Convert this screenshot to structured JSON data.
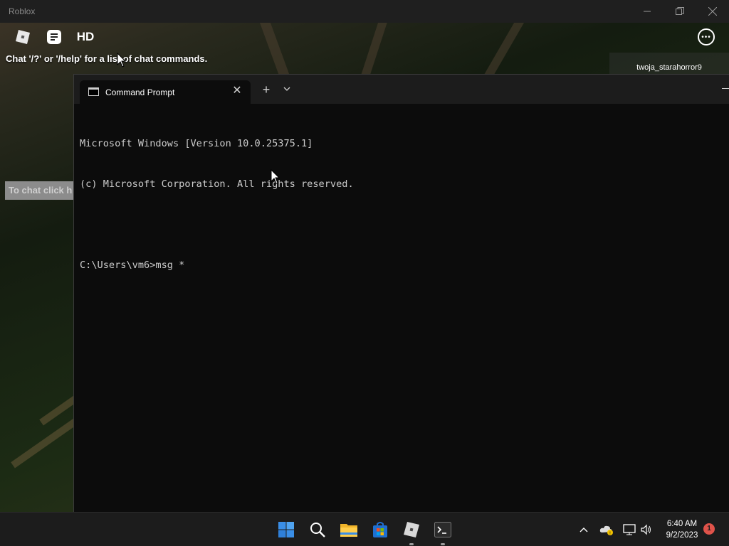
{
  "roblox": {
    "window_title": "Roblox",
    "chat_hint": "Chat '/?' or '/help' for a list of chat commands.",
    "chat_input_placeholder": "To chat click h",
    "username": "twoja_starahorror9",
    "hd_label": "HD",
    "more_label": "•••"
  },
  "terminal": {
    "tab_title": "Command Prompt",
    "lines": [
      "Microsoft Windows [Version 10.0.25375.1]",
      "(c) Microsoft Corporation. All rights reserved.",
      "",
      "C:\\Users\\vm6>msg *"
    ]
  },
  "taskbar": {
    "apps": [
      "start-icon",
      "search-icon",
      "file-explorer-icon",
      "store-icon",
      "roblox-icon",
      "terminal-icon"
    ],
    "time": "6:40 AM",
    "date": "9/2/2023",
    "notification_count": "1"
  },
  "colors": {
    "terminal_bg": "#0c0c0c",
    "terminal_text": "#cccccc",
    "taskbar_bg": "#1c1c1c",
    "start_blue": "#3a8ee6",
    "badge_red": "#e0534a"
  }
}
